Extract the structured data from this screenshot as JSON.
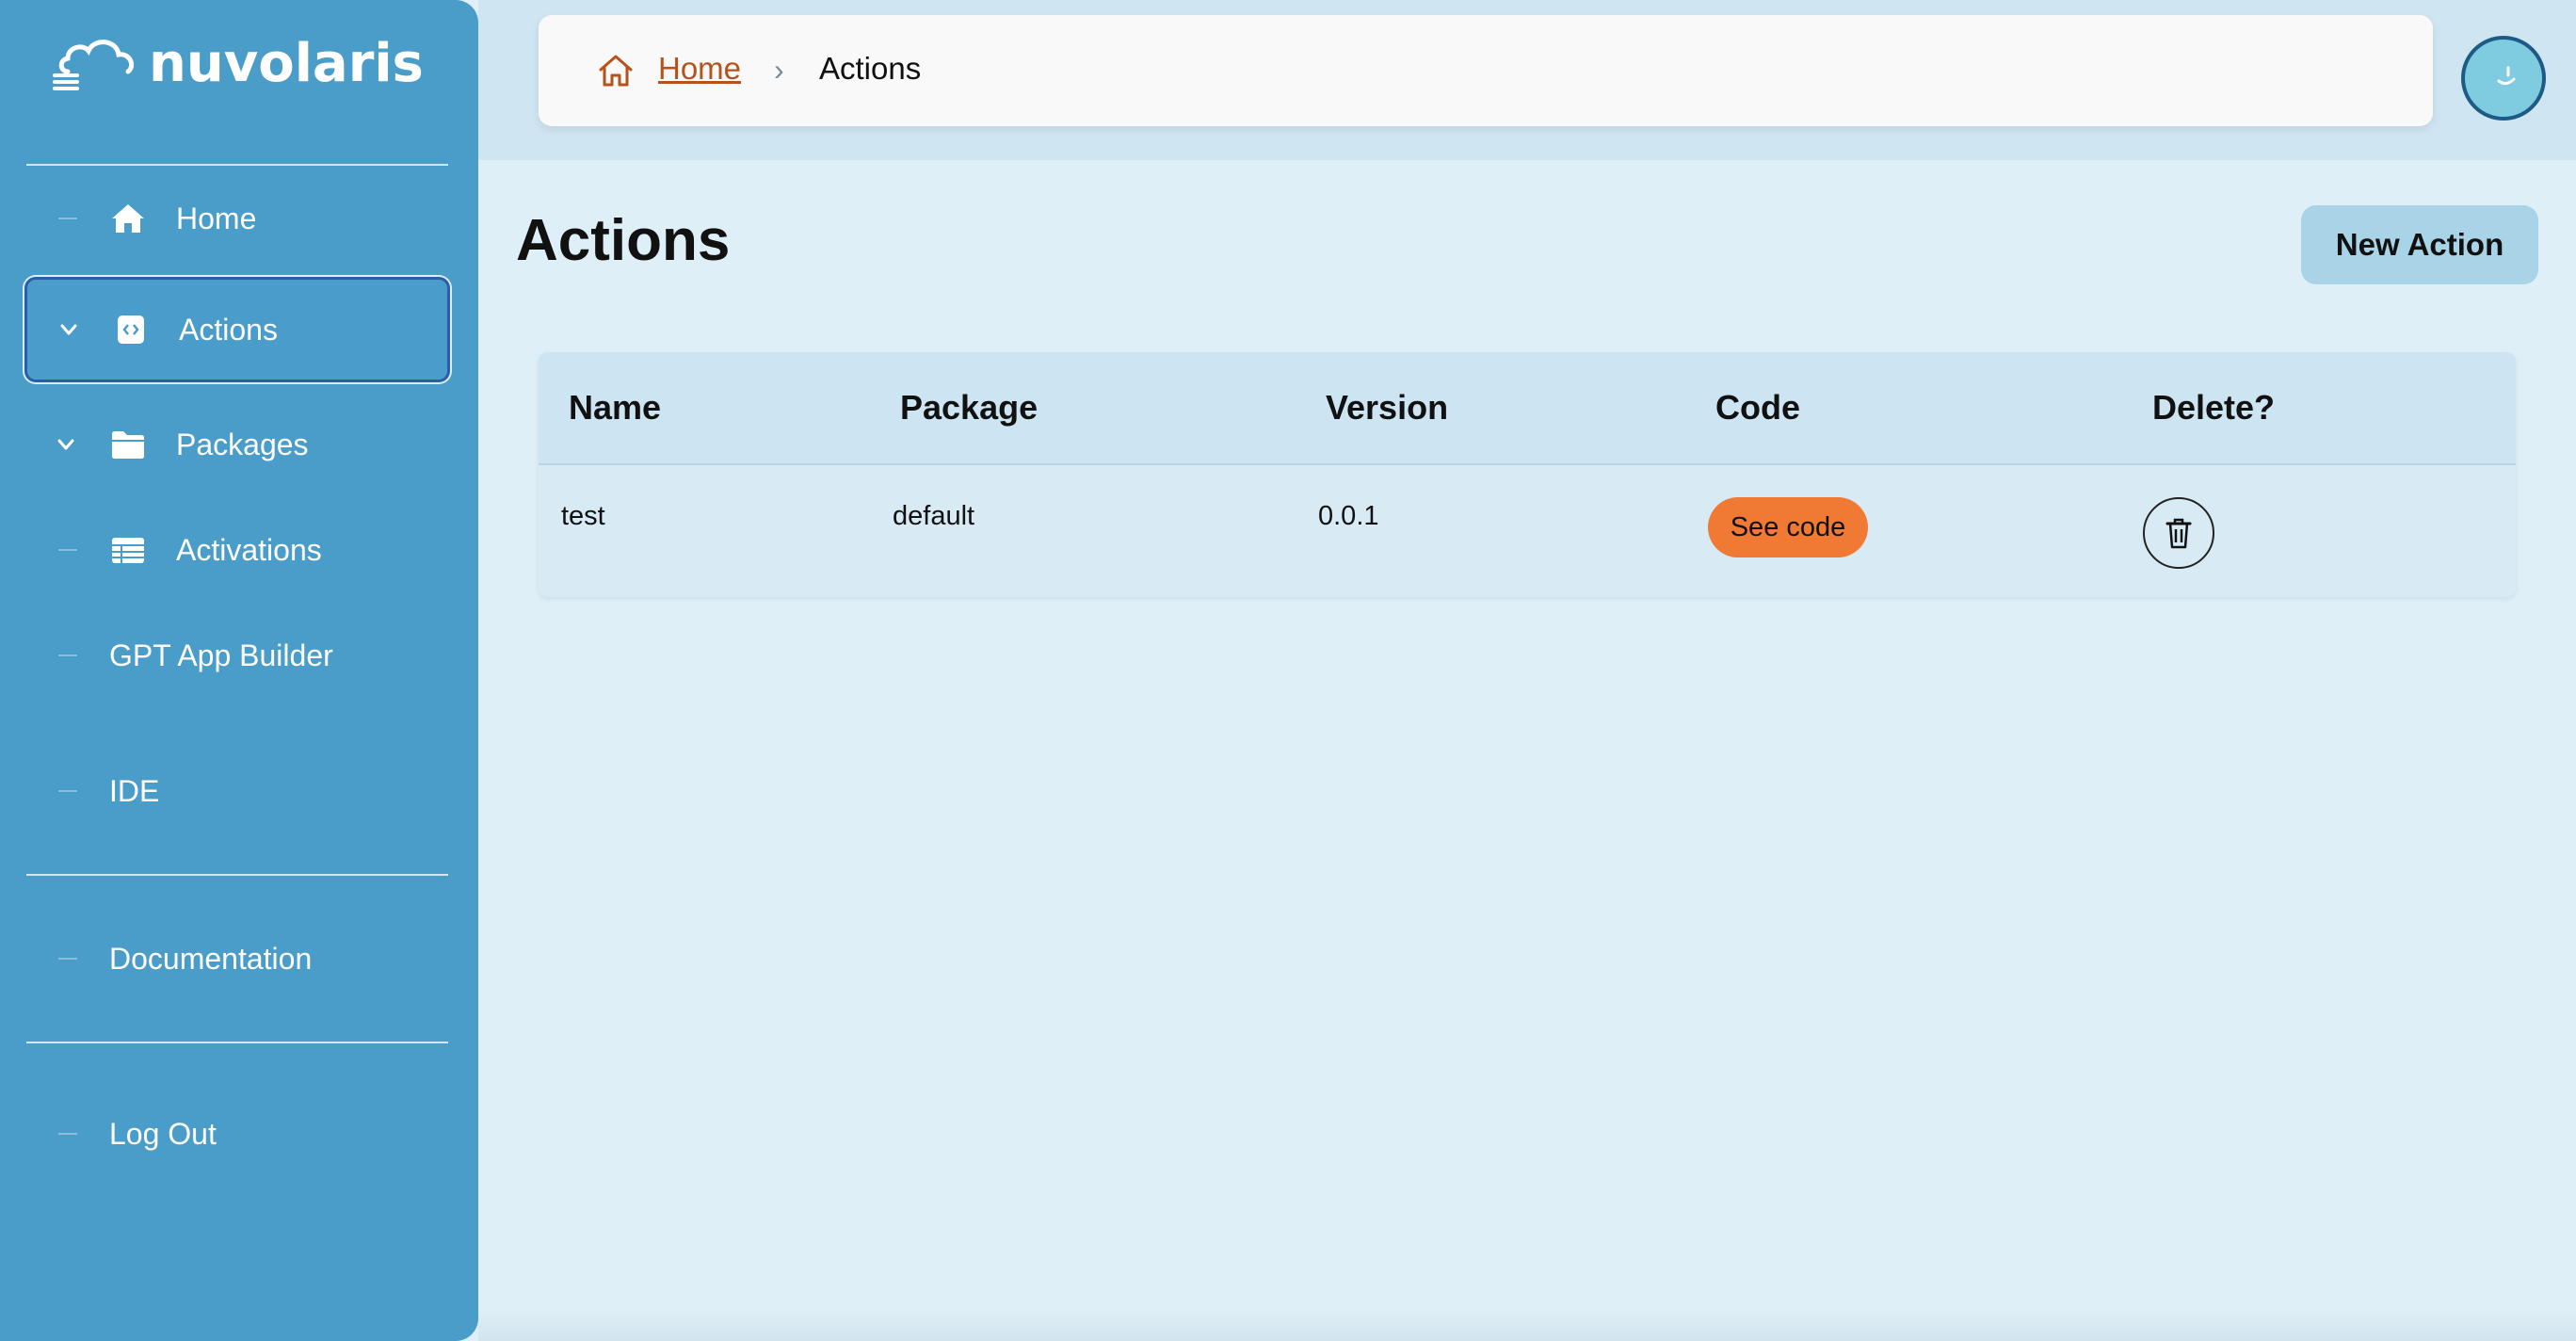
{
  "app": {
    "logo_text": "nuvolaris"
  },
  "sidebar": {
    "items": [
      {
        "label": "Home",
        "icon": "home-icon"
      },
      {
        "label": "Actions",
        "icon": "code-icon",
        "active": true
      },
      {
        "label": "Packages",
        "icon": "folder-icon"
      },
      {
        "label": "Activations",
        "icon": "table-icon"
      },
      {
        "label": "GPT App Builder"
      },
      {
        "label": "IDE"
      },
      {
        "label": "Documentation"
      },
      {
        "label": "Log Out"
      }
    ]
  },
  "breadcrumb": {
    "home_label": "Home",
    "separator": "›",
    "current": "Actions"
  },
  "main": {
    "title": "Actions",
    "new_action_label": "New Action"
  },
  "table": {
    "columns": [
      "Name",
      "Package",
      "Version",
      "Code",
      "Delete?"
    ],
    "rows": [
      {
        "name": "test",
        "package": "default",
        "version": "0.0.1",
        "code_label": "See code"
      }
    ]
  },
  "colors": {
    "sidebar": "#4b9dc9",
    "background": "#dfeff7",
    "accent_orange": "#f07a34",
    "link": "#b5531c",
    "button": "#a9d4e7"
  }
}
